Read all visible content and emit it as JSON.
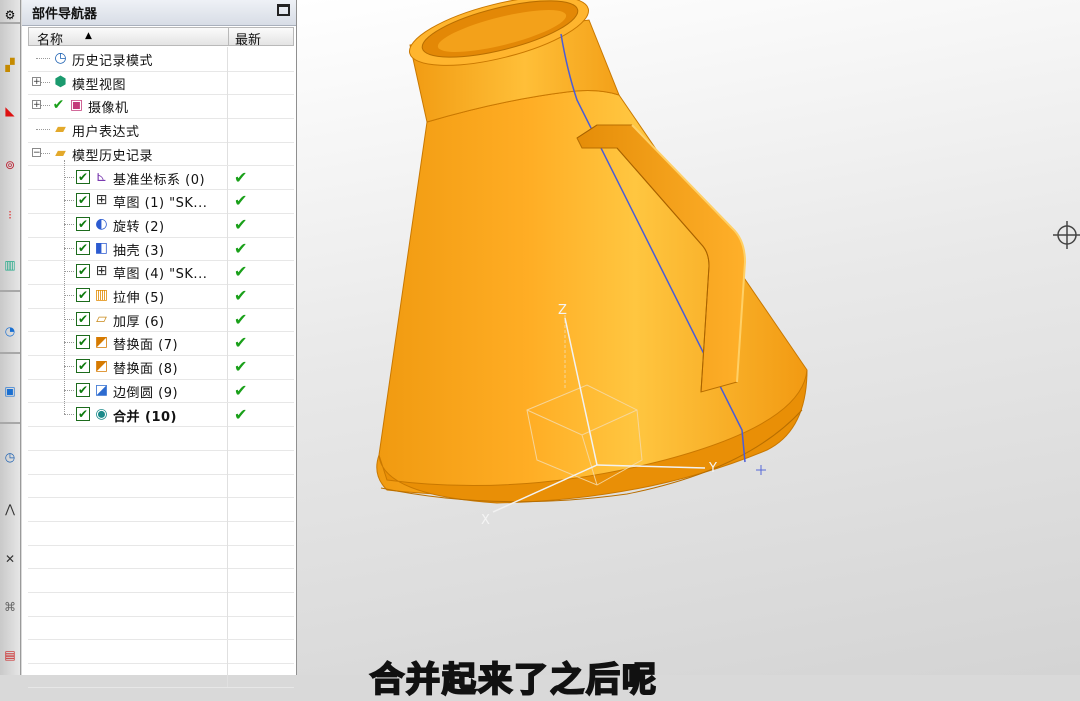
{
  "navigator": {
    "title": "部件导航器",
    "columns": {
      "name": "名称",
      "latest": "最新"
    },
    "items": [
      {
        "label": "历史记录模式",
        "icon": "clock-icon",
        "level": 0
      },
      {
        "label": "模型视图",
        "icon": "model-view-icon",
        "level": 0,
        "expander": "+"
      },
      {
        "label": "摄像机",
        "icon": "camera-icon",
        "level": 0,
        "expander": "+"
      },
      {
        "label": "用户表达式",
        "icon": "folder-icon",
        "level": 0
      },
      {
        "label": "模型历史记录",
        "icon": "folder-open-icon",
        "level": 0,
        "expander": "−"
      },
      {
        "label": "基准坐标系 (0)",
        "icon": "datum-csys-icon",
        "level": 1
      },
      {
        "label": "草图 (1) \"SK...",
        "icon": "sketch-icon",
        "level": 1
      },
      {
        "label": "旋转 (2)",
        "icon": "revolve-icon",
        "level": 1
      },
      {
        "label": "抽壳 (3)",
        "icon": "shell-icon",
        "level": 1
      },
      {
        "label": "草图 (4) \"SK...",
        "icon": "sketch-icon",
        "level": 1
      },
      {
        "label": "拉伸 (5)",
        "icon": "extrude-icon",
        "level": 1
      },
      {
        "label": "加厚 (6)",
        "icon": "thicken-icon",
        "level": 1
      },
      {
        "label": "替换面 (7)",
        "icon": "replace-face-icon",
        "level": 1
      },
      {
        "label": "替换面 (8)",
        "icon": "replace-face-icon",
        "level": 1
      },
      {
        "label": "边倒圆 (9)",
        "icon": "edge-blend-icon",
        "level": 1
      },
      {
        "label": "合并 (10)",
        "icon": "unite-icon",
        "level": 1,
        "bold": true
      }
    ]
  },
  "viewport": {
    "axis_labels": {
      "x": "X",
      "y": "Y",
      "z": "Z"
    },
    "subtitle": "合并起来了之后呢"
  },
  "colors": {
    "model": "#ffa51c",
    "checkmark": "#1aa01a",
    "subtitle": "#ffe100"
  }
}
